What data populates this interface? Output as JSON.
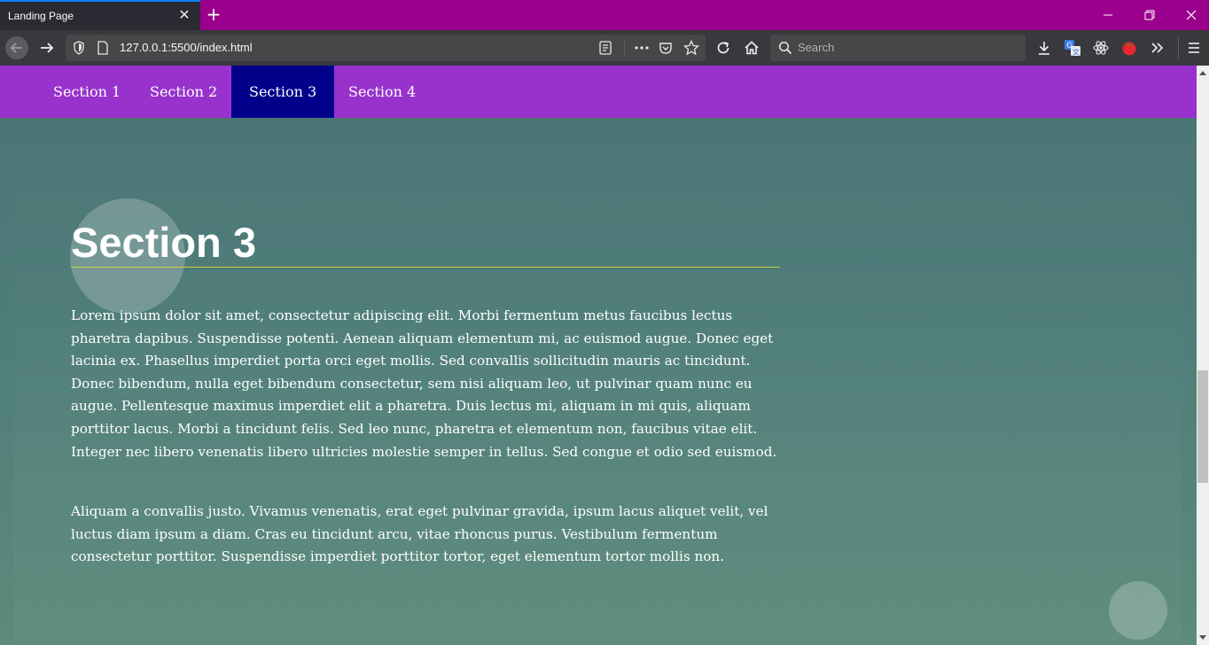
{
  "browser": {
    "tab": {
      "title": "Landing Page",
      "close_glyph": "✕"
    },
    "new_tab_glyph": "+",
    "address_bar": {
      "url": "127.0.0.1:5500/index.html"
    },
    "search_bar": {
      "placeholder": "Search"
    },
    "colors": {
      "titlebar": "#9a008b",
      "tab_active": "#2b2a33",
      "toolbar": "#38383d"
    },
    "icons": [
      "back-arrow-icon",
      "forward-arrow-icon",
      "shield-icon",
      "page-icon",
      "reader-view-icon",
      "more-dots-icon",
      "pocket-icon",
      "bookmark-star-icon",
      "reload-icon",
      "home-icon",
      "search-icon",
      "download-icon",
      "translate-icon",
      "react-devtools-icon",
      "tomato-timer-icon",
      "overflow-chevrons-icon",
      "hamburger-menu-icon",
      "minimize-icon",
      "restore-icon",
      "close-icon"
    ]
  },
  "page": {
    "nav": {
      "items": [
        {
          "label": "Section 1",
          "active": false
        },
        {
          "label": "Section 2",
          "active": false
        },
        {
          "label": "Section 3",
          "active": true
        },
        {
          "label": "Section 4",
          "active": false
        }
      ],
      "colors": {
        "background": "#9932cc",
        "active": "#00008b"
      }
    },
    "section": {
      "title": "Section 3",
      "paragraphs": [
        "Lorem ipsum dolor sit amet, consectetur adipiscing elit. Morbi fermentum metus faucibus lectus pharetra dapibus. Suspendisse potenti. Aenean aliquam elementum mi, ac euismod augue. Donec eget lacinia ex. Phasellus imperdiet porta orci eget mollis. Sed convallis sollicitudin mauris ac tincidunt. Donec bibendum, nulla eget bibendum consectetur, sem nisi aliquam leo, ut pulvinar quam nunc eu augue. Pellentesque maximus imperdiet elit a pharetra. Duis lectus mi, aliquam in mi quis, aliquam porttitor lacus. Morbi a tincidunt felis. Sed leo nunc, pharetra et elementum non, faucibus vitae elit. Integer nec libero venenatis libero ultricies molestie semper in tellus. Sed congue et odio sed euismod.",
        "Aliquam a convallis justo. Vivamus venenatis, erat eget pulvinar gravida, ipsum lacus aliquet velit, vel luctus diam ipsum a diam. Cras eu tincidunt arcu, vitae rhoncus purus. Vestibulum fermentum consectetur porttitor. Suspendisse imperdiet porttitor tortor, eget elementum tortor mollis non."
      ],
      "colors": {
        "background": "#4e7c79",
        "title_rule": "#c8d03a",
        "text": "#ffffff"
      }
    }
  }
}
